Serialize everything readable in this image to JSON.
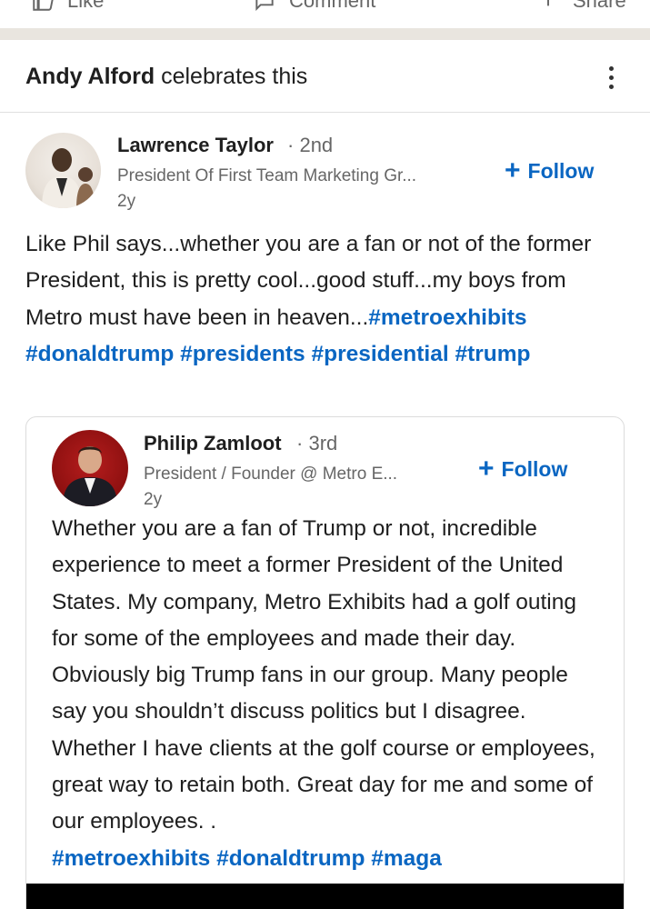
{
  "action_bar": {
    "like_label": "Like",
    "comment_label": "Comment",
    "share_label": "Share"
  },
  "activity": {
    "actor": "Andy Alford",
    "verb": "celebrates this"
  },
  "post": {
    "author": {
      "name": "Lawrence Taylor",
      "degree": "2nd",
      "headline": "President Of First Team Marketing Gr...",
      "age": "2y"
    },
    "follow_label": "Follow",
    "text_prefix": "Like Phil says...whether you are a fan or not of the former President, this is pretty cool...good stuff...my boys from Metro must have been in heaven...",
    "hashtags": [
      "#metroexhibits",
      "#donaldtrump",
      "#presidents",
      "#presidential",
      "#trump"
    ]
  },
  "shared_post": {
    "author": {
      "name": "Philip Zamloot",
      "degree": "3rd",
      "headline": "President / Founder @ Metro E...",
      "age": "2y"
    },
    "follow_label": "Follow",
    "text": "Whether you are a fan of Trump or not, incredible experience to meet a former President of the United States. My company, Metro Exhibits had a golf outing for some of the employees and made their day. Obviously big Trump fans in our group. Many people say you shouldn’t discuss politics but I disagree. Whether I have clients at the golf course or employees, great way to retain both. Great day for me and some of our employees. .",
    "hashtags": [
      "#metroexhibits",
      "#donaldtrump",
      "#maga"
    ]
  },
  "colors": {
    "link_blue": "#0a66c2",
    "secondary_text": "#666666",
    "separator": "#e9e5df"
  },
  "icons": [
    "like-icon",
    "comment-icon",
    "share-icon",
    "more-options-icon",
    "plus-icon"
  ]
}
